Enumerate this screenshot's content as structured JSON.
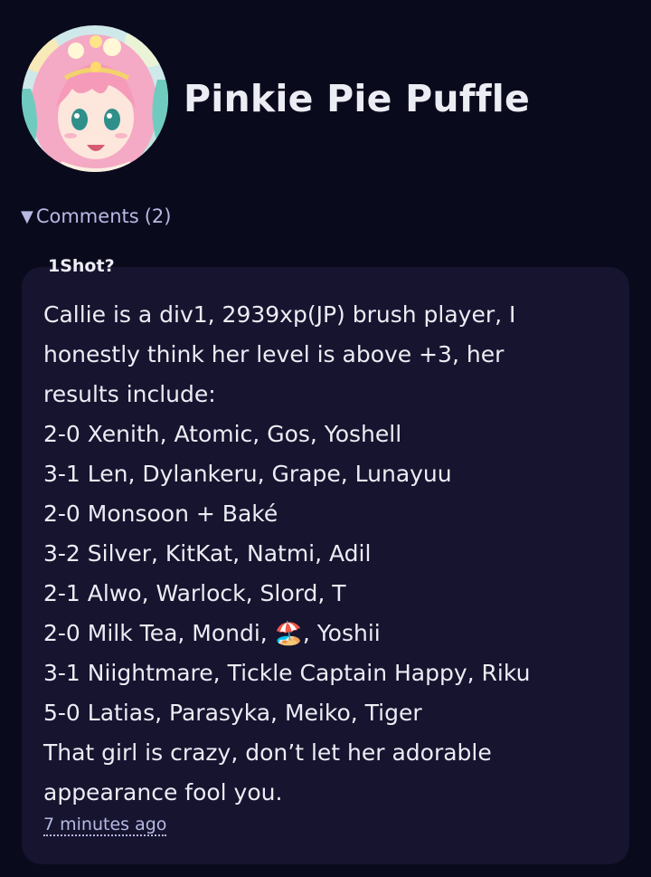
{
  "profile": {
    "name": "Pinkie Pie Puffle",
    "avatar_icon": "anime-character-avatar"
  },
  "comments": {
    "label": "Comments",
    "count": "(2)",
    "toggle_glyph": "▼",
    "items": [
      {
        "author": "1Shot?",
        "lines": [
          "Callie is a div1, 2939xp(JP) brush player, I",
          "honestly think her level is above +3, her",
          "results include:",
          "2-0 Xenith, Atomic, Gos, Yoshell",
          "3-1 Len, Dylankeru, Grape, Lunayuu",
          "2-0 Monsoon + Baké",
          "3-2 Silver, KitKat, Natmi, Adil",
          "2-1 Alwo, Warlock, Slord, T",
          "2-0 Milk Tea, Mondi, 🏖️, Yoshii",
          "3-1 Niightmare, Tickle Captain Happy, Riku",
          "5-0 Latias, Parasyka, Meiko, Tiger",
          "That girl is crazy, don’t let her adorable",
          "appearance fool you."
        ],
        "timestamp": "7 minutes ago"
      }
    ]
  },
  "colors": {
    "background": "#0a0a1d",
    "card": "#16142f",
    "text": "#ececf4",
    "muted_accent": "#b7b9e2"
  }
}
